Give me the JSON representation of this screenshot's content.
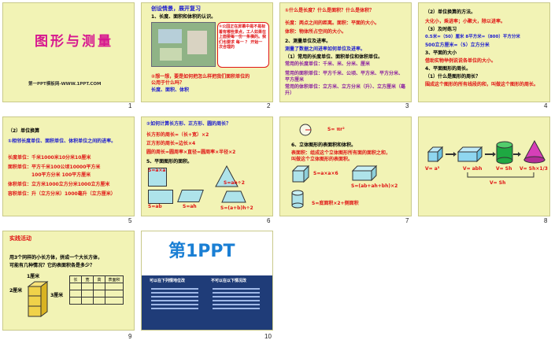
{
  "slides": [
    {
      "num": "1",
      "title": "图形与测量",
      "footer": "第一PPT模板网-WWW.1PPT.COM"
    },
    {
      "num": "2",
      "heading": "创设情景，展开复习",
      "line1": "1、长度、面积和体积的认识。",
      "bubble": "①公园正在屏幕中是不是标着有哪些景点，工人如果在上面要每一份一条横的。我们也要求 每一 ？ 开始一次合理的",
      "q2": "②想一想，要是如何把怎么样把我们面积单位的",
      "q2b": "公用于什么吗？",
      "ans": "长度、面积、体积"
    },
    {
      "num": "3",
      "q": "①什么是长度？什么是面积？什么是体积？",
      "l1": "长度：两点之间的距离。面积：平面的大小。",
      "l2": "体积：物体所占空间的大小。",
      "h2": "2、测量单位及进率。",
      "h2b": "测量了数据之间进率如何单位及进率。",
      "l3": "（1）常用的长度单位、面积单位和体积单位。",
      "l4": "常用的长度单位：千米、米、分米、厘米",
      "l5": "常用的面积单位：平方千米、公顷、平方米、平方分米、平方厘米",
      "l6": "常用的体积单位：立方米、立方分米（升）、立方厘米（毫升）"
    },
    {
      "num": "4",
      "h": "（2）单位换算的方法。",
      "l1": "大化小，乘进率；小聚大，除以进率。",
      "l2": "（3）及时练习",
      "l3": "0.5米=（50）厘米  8平方米=（800）平方分米",
      "l4": "500立方厘米=（5）立方分米",
      "l5": "3、平面的大小",
      "l6": "借助实物举例说说各单位的大小。",
      "l7": "4、平面图形的周长。",
      "l8": "（1）什么是图形的周长？",
      "l9": "围成这个图形的所有线段的和，叫做这个图形的周长。"
    },
    {
      "num": "5",
      "h": "（2）单位换算",
      "l1": "①相邻长度单位、面积单位、体积单位之间的进率。",
      "l2": "长度单位：千米1000米10分米10厘米",
      "l3": "面积单位：平方千米100公顷10000平方米",
      "l4": "100平方分米  100平方厘米",
      "l5": "体积单位：立方米1000立方分米1000立方厘米",
      "l6": "容积单位：升（立方分米）1000毫升（立方厘米）"
    },
    {
      "num": "6",
      "h": "②如何计算长方形、正方形、圆的周长？",
      "l1": "长方形的周长=（长+宽）×2",
      "l2": "正方形的周长=边长×4",
      "l3": "圆的周长=圆周率×直径=圆周率×半径×2",
      "l4": "5、平面图形的面积。",
      "f1": "S=a×a",
      "f2": "S=ah",
      "f3": "S=ab",
      "f4": "S=ah÷2",
      "f5": "S=(a+b)h÷2"
    },
    {
      "num": "7",
      "f0": "S= πr²",
      "l1": "6、立体图形的表面积和体积。",
      "l2": "表面积：组成这个立体图形所有面的面积之和，",
      "l3": "叫做这个立体图形的表面积。",
      "f1": "S=a×a×6",
      "f2": "S=(ab+ah+bh)×2",
      "f3": "S=底面积×2+侧面积"
    },
    {
      "num": "8",
      "f1": "V= a³",
      "f2": "V= abh",
      "f3": "V= Sh",
      "f4": "V= Sh×1/3",
      "f5": "V= Sh"
    },
    {
      "num": "9",
      "h": "实践活动",
      "l1": "用3个同样的小长方体，拼成一个大长方体，",
      "l2": "可能有几种情况？它的表面积各是多少？",
      "d1": "1厘米",
      "d2": "2厘米",
      "d3": "3厘米",
      "cols": [
        "长",
        "宽",
        "高",
        "表面积"
      ]
    },
    {
      "num": "10",
      "logo": "第1PPT",
      "b1": "可以在下列情地位改",
      "b2": "不可以在以下情况改"
    }
  ]
}
